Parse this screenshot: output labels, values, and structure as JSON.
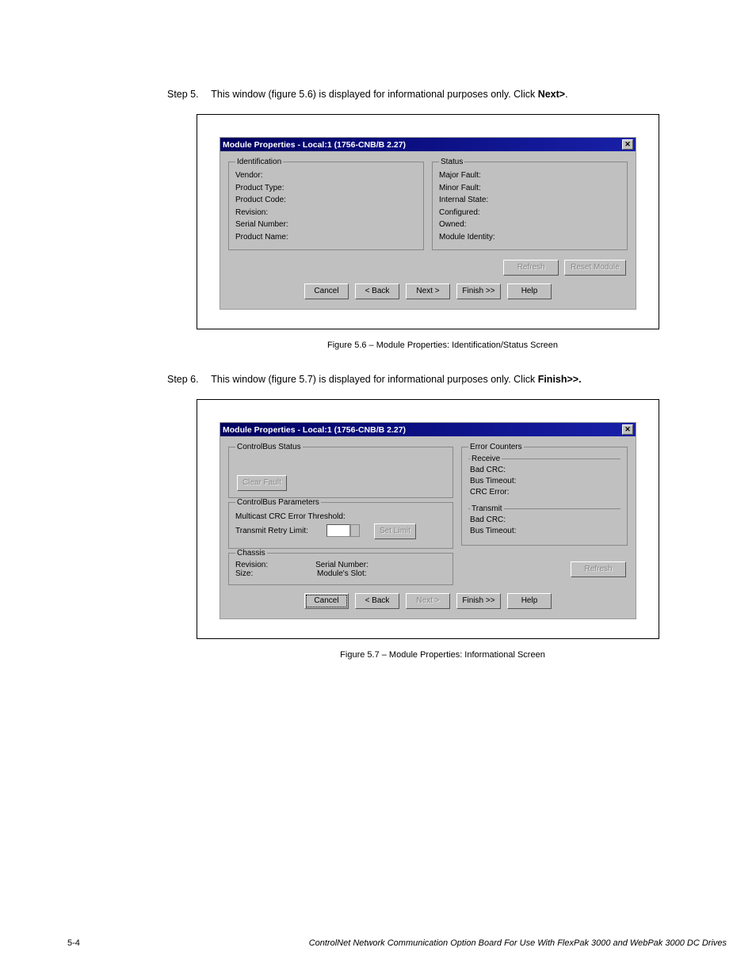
{
  "step5": {
    "label": "Step 5.",
    "text_a": "This window (figure 5.6) is displayed for informational purposes only. Click ",
    "bold": "Next>",
    "text_b": "."
  },
  "dialog1": {
    "title": "Module Properties - Local:1 (1756-CNB/B 2.27)",
    "close": "✕",
    "id_legend": "Identification",
    "id_labels": {
      "vendor": "Vendor:",
      "ptype": "Product Type:",
      "pcode": "Product Code:",
      "rev": "Revision:",
      "serial": "Serial Number:",
      "pname": "Product Name:"
    },
    "status_legend": "Status",
    "status_labels": {
      "major": "Major Fault:",
      "minor": "Minor Fault:",
      "internal": "Internal State:",
      "configured": "Configured:",
      "owned": "Owned:",
      "identity": "Module Identity:"
    },
    "btn_refresh": "Refresh",
    "btn_reset": "Reset Module",
    "btn_cancel": "Cancel",
    "btn_back": "< Back",
    "btn_next": "Next >",
    "btn_finish": "Finish >>",
    "btn_help": "Help"
  },
  "caption1": "Figure 5.6 – Module Properties: Identification/Status Screen",
  "step6": {
    "label": "Step 6.",
    "text_a": "This window (figure 5.7) is displayed for informational purposes only. Click ",
    "bold": "Finish>>."
  },
  "dialog2": {
    "title": "Module Properties - Local:1 (1756-CNB/B 2.27)",
    "close": "✕",
    "cb_status_legend": "ControlBus Status",
    "btn_clear": "Clear Fault",
    "cb_params_legend": "ControlBus Parameters",
    "mcrc": "Multicast CRC Error Threshold:",
    "retry": "Transmit Retry Limit:",
    "btn_setlimit": "Set Limit",
    "chassis_legend": "Chassis",
    "chassis": {
      "rev": "Revision:",
      "serial": "Serial Number:",
      "size": "Size:",
      "slot": "Module's Slot:"
    },
    "err_legend": "Error Counters",
    "receive_legend": "Receive",
    "receive": {
      "badcrc": "Bad CRC:",
      "bustimeout": "Bus Timeout:",
      "crcerror": "CRC Error:"
    },
    "transmit_legend": "Transmit",
    "transmit": {
      "badcrc": "Bad CRC:",
      "bustimeout": "Bus Timeout:"
    },
    "btn_refresh": "Refresh",
    "btn_cancel": "Cancel",
    "btn_back": "< Back",
    "btn_next": "Next >",
    "btn_finish": "Finish >>",
    "btn_help": "Help"
  },
  "caption2": "Figure 5.7 – Module Properties: Informational Screen",
  "footer": {
    "page": "5-4",
    "doc": "ControlNet Network Communication Option Board For Use With FlexPak 3000 and WebPak 3000 DC Drives"
  }
}
